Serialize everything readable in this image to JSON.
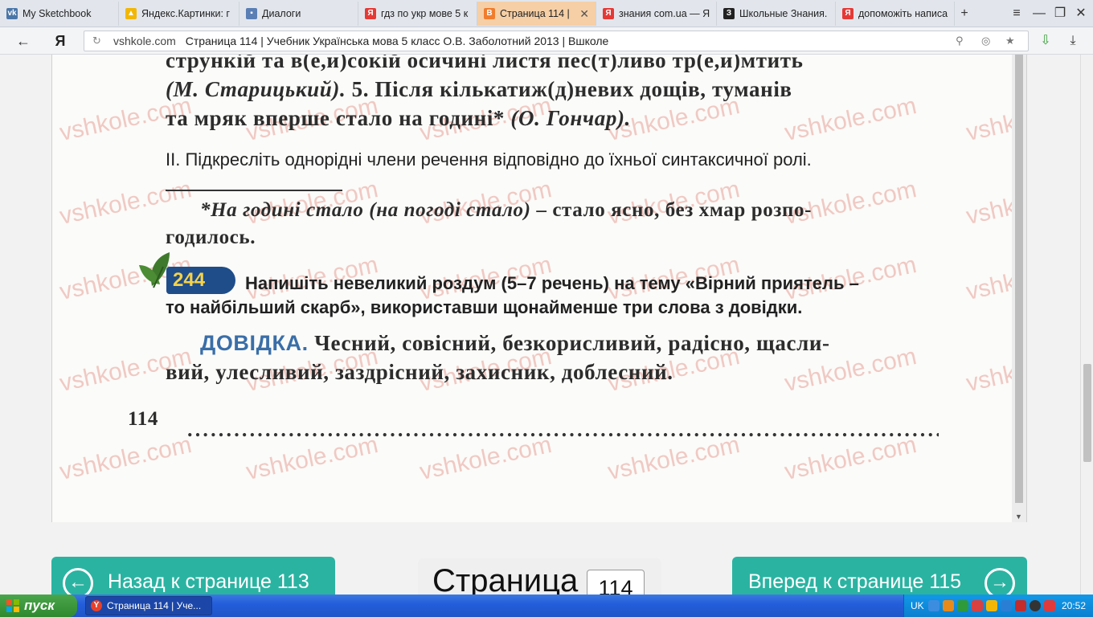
{
  "browser": {
    "tabs": [
      {
        "label": "My Sketchbook",
        "icon": "vk-icon",
        "color": "#4a76a8",
        "glyph": "vk"
      },
      {
        "label": "Яндекс.Картинки: г",
        "icon": "yandex-images-icon",
        "color": "#f2b705",
        "glyph": "▲"
      },
      {
        "label": "Диалоги",
        "icon": "dialog-icon",
        "color": "#5a7fb5",
        "glyph": "▪"
      },
      {
        "label": "гдз по укр мове 5 к",
        "icon": "yandex-icon",
        "color": "#e53935",
        "glyph": "Я"
      },
      {
        "label": "Страница 114 |",
        "icon": "vshkole-icon",
        "color": "#f07d2e",
        "glyph": "B",
        "active": true
      },
      {
        "label": "знания com.ua — Я",
        "icon": "yandex-icon",
        "color": "#e53935",
        "glyph": "Я"
      },
      {
        "label": "Школьные Знания.",
        "icon": "znanija-icon",
        "color": "#222222",
        "glyph": "З"
      },
      {
        "label": "допоможіть написа",
        "icon": "yandex-icon",
        "color": "#e53935",
        "glyph": "Я"
      }
    ],
    "new_tab_glyph": "+",
    "menu_glyph": "≡",
    "minimize_glyph": "—",
    "maximize_glyph": "❐",
    "close_glyph": "✕",
    "back_glyph": "←",
    "yandex_glyph": "Я",
    "address": {
      "domain": "vshkole.com",
      "title": "Страница 114 | Учебник Українська мова 5 класс О.В. Заболотний 2013 | Вшколе"
    }
  },
  "page": {
    "lines": {
      "l1": "стрункій та в(е,и)сокій осичині листя пес(т)ливо тр(е,и)мтить",
      "l2_italic": "(М. Старицький).",
      "l2_rest": " 5. Після кількатиж(д)невих дощів, туманів",
      "l3_plain": "та мряк вперше стало на годині* ",
      "l3_italic": "(О. Гончар).",
      "task2": "ІІ. Підкресліть однорідні члени речення відповідно до їхньої синтаксичної ролі.",
      "foot1_italic": "*На годині стало (на погоді стало)",
      "foot1_rest": " – стало ясно, без хмар розпо-",
      "foot2": "годилось.",
      "ex_number": "244",
      "ex1": "Напишіть невеликий роздум (5–7 речень) на тему «Вірний приятель –",
      "ex2": "то найбільший скарб», використавши щонайменше три слова з довідки.",
      "dovidka_label": "ДОВІДКА.",
      "dovidka1": " Чесний, совісний, безкорисливий, радісно, щасли-",
      "dovidka2": "вий, улесливий, заздрісний, захисник, доблесний.",
      "page_num": "114",
      "dots": "...................................................................................................."
    },
    "watermark": "vshkole.com"
  },
  "nav": {
    "back_label": "Назад к странице 113",
    "forward_label": "Вперед к странице 115",
    "page_label": "Страница",
    "page_value": "114"
  },
  "taskbar": {
    "start_label": "пуск",
    "task_label": "Страница 114 | Уче...",
    "lang": "UK",
    "clock": "20:52"
  }
}
